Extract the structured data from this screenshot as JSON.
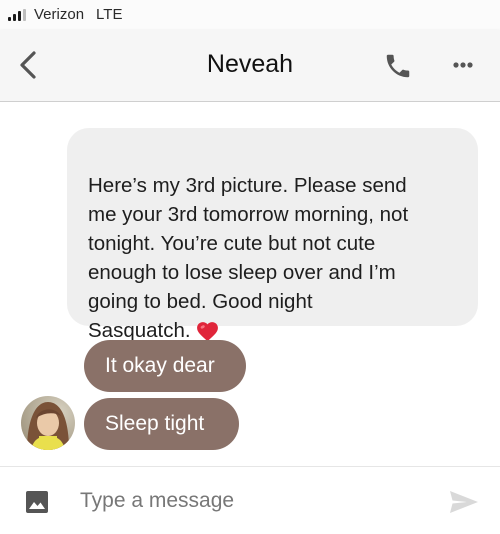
{
  "status_bar": {
    "carrier": "Verizon",
    "network": "LTE"
  },
  "header": {
    "title": "Neveah"
  },
  "messages": [
    {
      "direction": "received",
      "text": "Here’s my 3rd picture. Please send\nme your 3rd tomorrow morning, not\ntonight. You’re cute but not cute\nenough to lose sleep over and I’m\ngoing to bed. Good night\nSasquatch.",
      "emoji": "red-heart-icon"
    },
    {
      "direction": "sent",
      "text": "It okay dear"
    },
    {
      "direction": "sent",
      "text": "Sleep tight"
    }
  ],
  "composer": {
    "placeholder": "Type a message",
    "value": ""
  },
  "colors": {
    "sent_bubble": "#8a7168",
    "received_bubble": "#efefef",
    "header_bg": "#f6f6f6",
    "icon_gray": "#555555",
    "send_icon_disabled": "#d9d9d9"
  }
}
